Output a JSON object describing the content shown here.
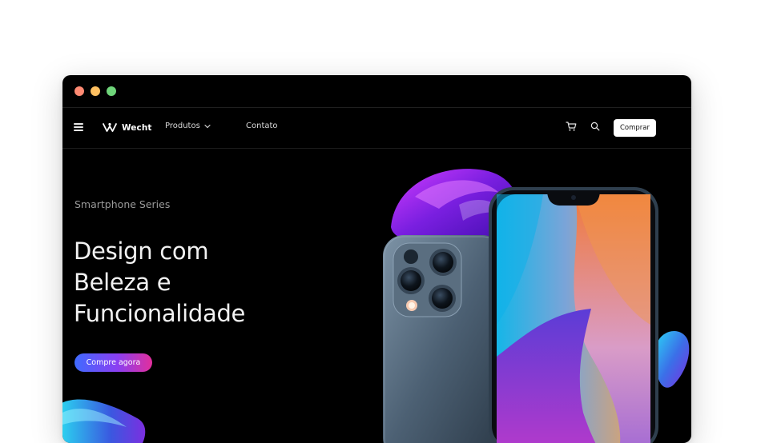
{
  "window": {
    "controls": [
      "close",
      "minimize",
      "maximize"
    ]
  },
  "nav": {
    "menu_icon": "hamburger-icon",
    "brand": "Wecht",
    "links": [
      {
        "label": "Produtos",
        "icon": "chevron-down-icon"
      },
      {
        "label": "Contato"
      }
    ],
    "cart_icon": "cart-icon",
    "search_icon": "search-icon",
    "buy_label": "Comprar"
  },
  "hero": {
    "eyebrow": "Smartphone Series",
    "headline_lines": [
      "Design com",
      "Beleza e",
      "Funcionalidade"
    ],
    "cta_label": "Compre agora"
  },
  "colors": {
    "background": "#000000",
    "cta_gradient": [
      "#3f6bff",
      "#8a3ff2",
      "#e22f9c"
    ],
    "accent_purple": "#8a2be2"
  }
}
